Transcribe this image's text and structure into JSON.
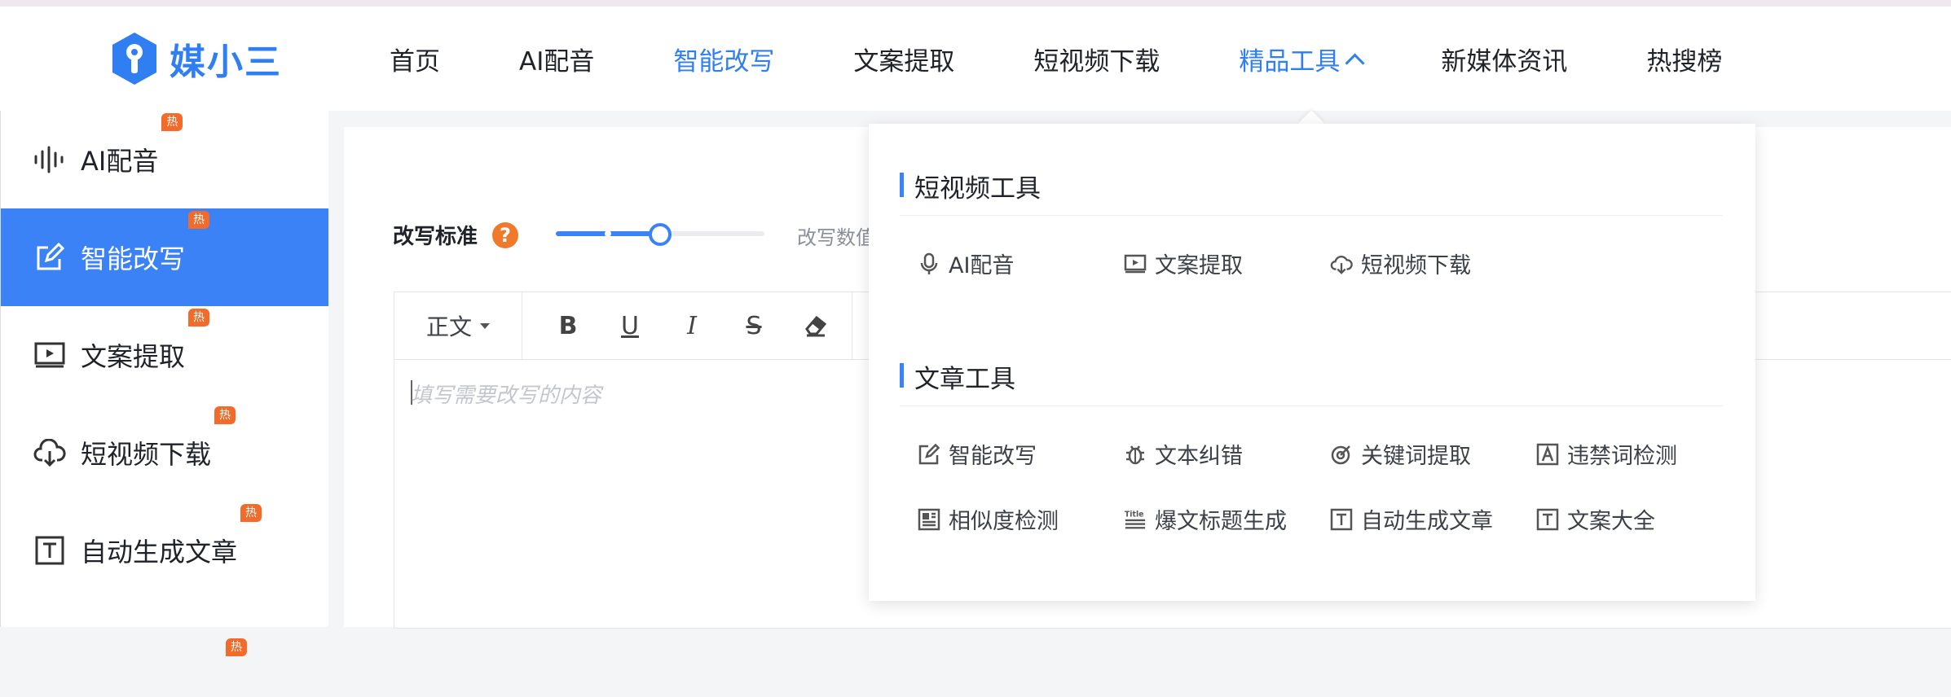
{
  "brand": {
    "name": "媒小三"
  },
  "nav": {
    "items": [
      {
        "label": "首页"
      },
      {
        "label": "AI配音"
      },
      {
        "label": "智能改写"
      },
      {
        "label": "文案提取"
      },
      {
        "label": "短视频下载"
      },
      {
        "label": "精品工具"
      },
      {
        "label": "新媒体资讯"
      },
      {
        "label": "热搜榜"
      }
    ],
    "active_index": 2,
    "open_index": 5
  },
  "sidebar": {
    "items": [
      {
        "label": "AI配音",
        "badge": "热"
      },
      {
        "label": "智能改写",
        "badge": "热"
      },
      {
        "label": "文案提取",
        "badge": "热"
      },
      {
        "label": "短视频下载",
        "badge": "热"
      },
      {
        "label": "自动生成文章",
        "badge": "热"
      },
      {
        "label": "",
        "badge": "热"
      }
    ],
    "active_index": 1
  },
  "rewrite": {
    "standard_label": "改写标准",
    "help_glyph": "?",
    "slider_value": 0.5,
    "slider_note": "改写数值"
  },
  "editor": {
    "format_select": "正文",
    "toolbar": {
      "bold": "B",
      "underline": "U",
      "italic": "I",
      "strike": "S"
    },
    "placeholder": "填写需要改写的内容"
  },
  "dropdown": {
    "sections": [
      {
        "title": "短视频工具",
        "tools": [
          {
            "label": "AI配音",
            "icon": "microphone-icon"
          },
          {
            "label": "文案提取",
            "icon": "video-icon"
          },
          {
            "label": "短视频下载",
            "icon": "cloud-download-icon"
          }
        ]
      },
      {
        "title": "文章工具",
        "tools": [
          {
            "label": "智能改写",
            "icon": "edit-icon"
          },
          {
            "label": "文本纠错",
            "icon": "bug-icon"
          },
          {
            "label": "关键词提取",
            "icon": "target-icon"
          },
          {
            "label": "违禁词检测",
            "icon": "text-box-icon"
          },
          {
            "label": "相似度检测",
            "icon": "compare-icon"
          },
          {
            "label": "爆文标题生成",
            "icon": "title-icon"
          },
          {
            "label": "自动生成文章",
            "icon": "text-t-icon"
          },
          {
            "label": "文案大全",
            "icon": "text-t-icon"
          }
        ]
      }
    ]
  },
  "colors": {
    "accent": "#3b82f6",
    "hot_badge": "#f26b2b",
    "help": "#f07a2a"
  }
}
